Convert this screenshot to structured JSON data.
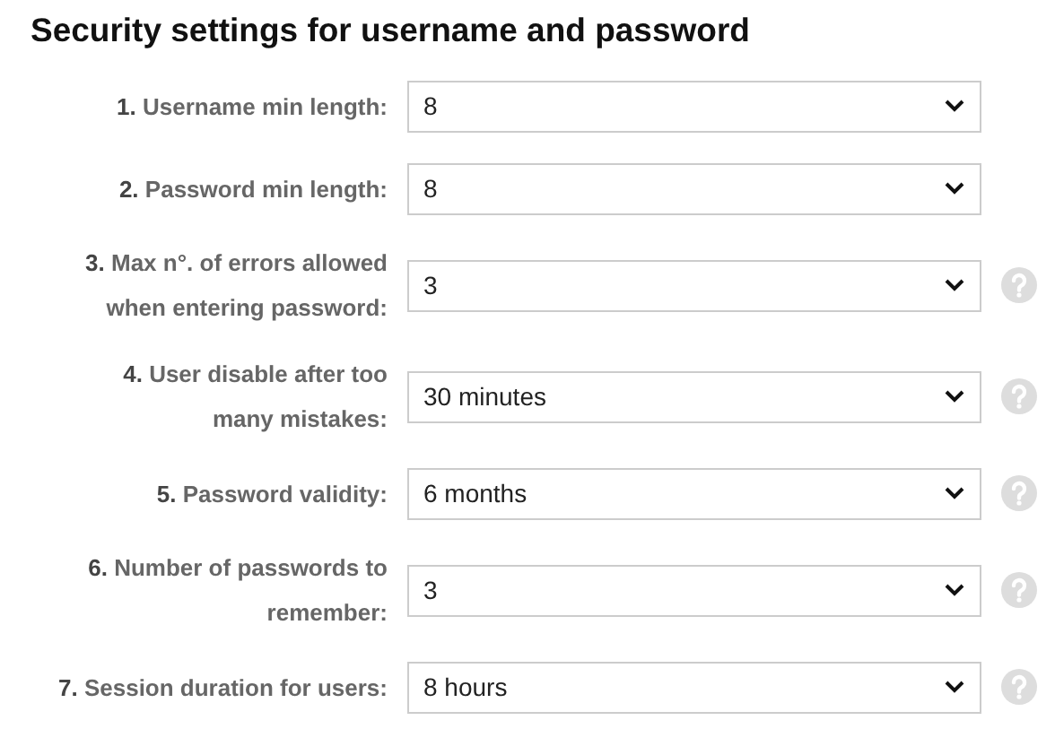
{
  "title": "Security settings for username and password",
  "settings": [
    {
      "number": "1.",
      "label": "Username min length:",
      "value": "8",
      "help": false
    },
    {
      "number": "2.",
      "label": "Password min length:",
      "value": "8",
      "help": false
    },
    {
      "number": "3.",
      "label": "Max n°. of errors allowed when entering password:",
      "value": "3",
      "help": true
    },
    {
      "number": "4.",
      "label": "User disable after too many mistakes:",
      "value": "30 minutes",
      "help": true
    },
    {
      "number": "5.",
      "label": "Password validity:",
      "value": "6 months",
      "help": true
    },
    {
      "number": "6.",
      "label": "Number of passwords to remember:",
      "value": "3",
      "help": true
    },
    {
      "number": "7.",
      "label": "Session duration for users:",
      "value": "8 hours",
      "help": true
    }
  ]
}
